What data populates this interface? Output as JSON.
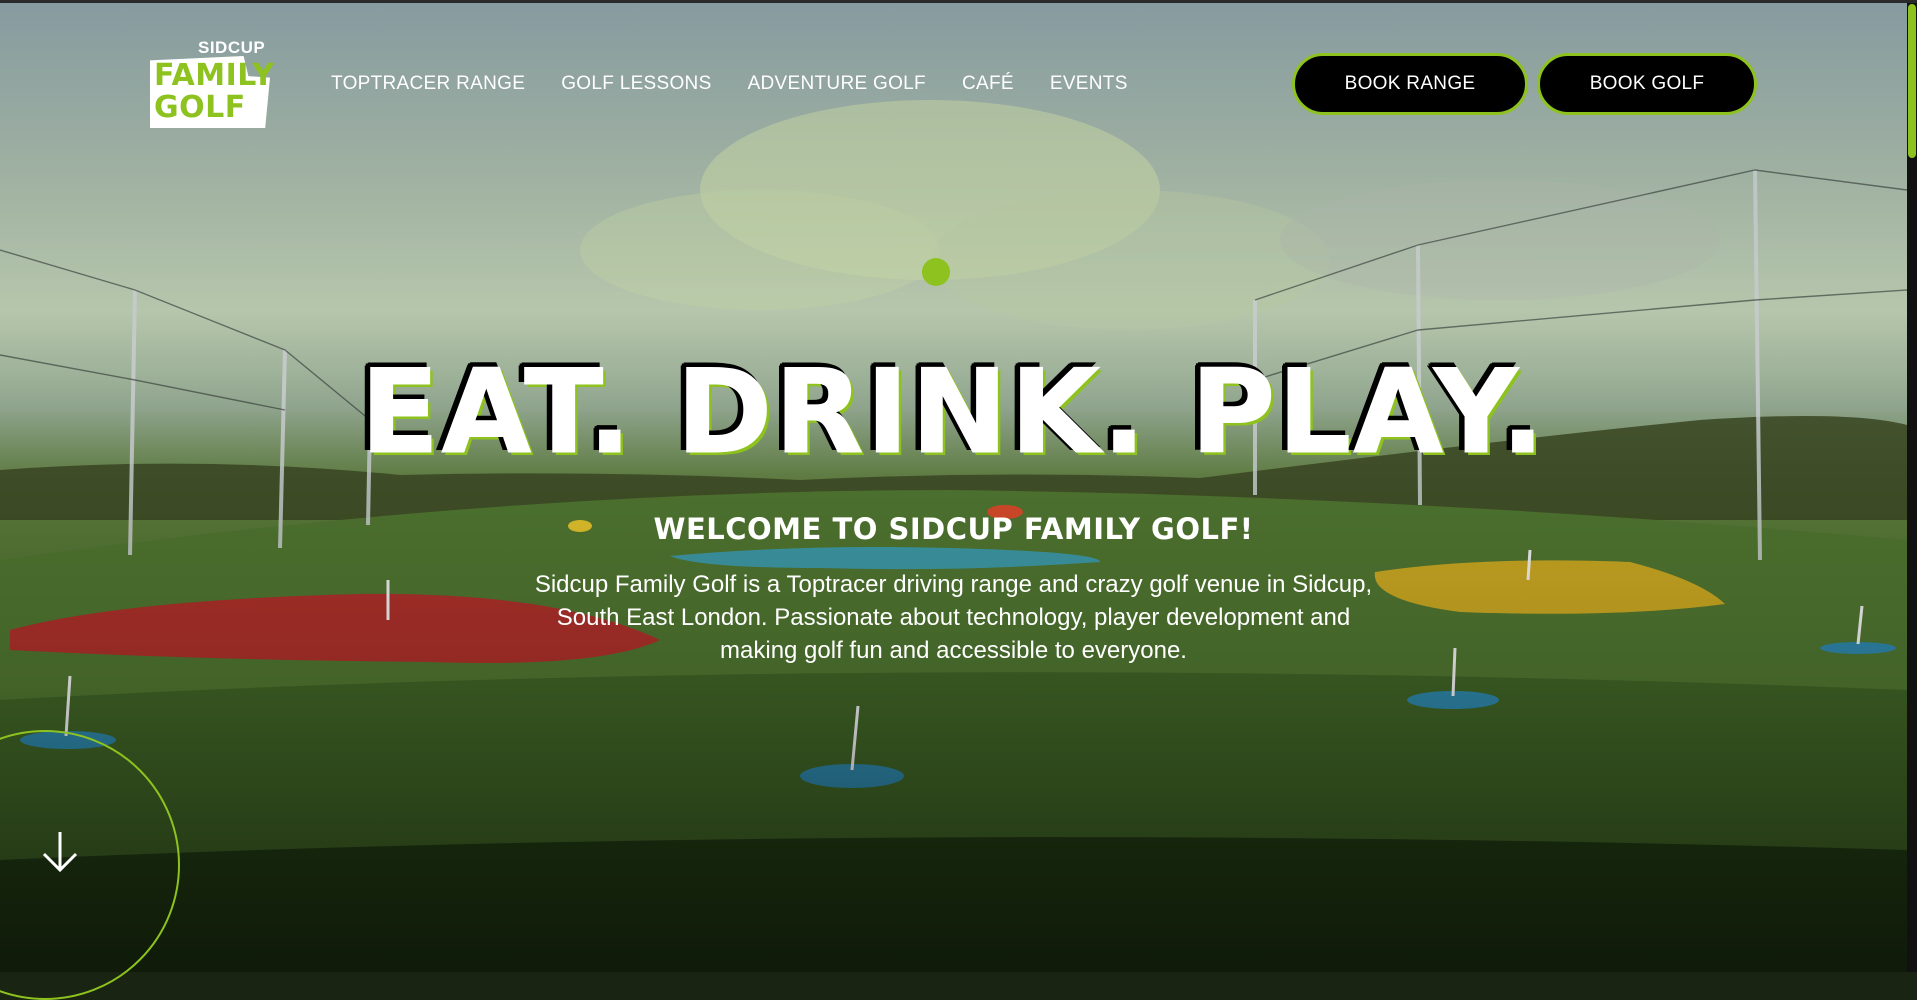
{
  "brand": {
    "top": "SIDCUP",
    "line1": "FAMILY",
    "line2": "GOLF"
  },
  "nav": {
    "items": [
      "TOPTRACER RANGE",
      "GOLF LESSONS",
      "ADVENTURE GOLF",
      "CAFÉ",
      "EVENTS"
    ]
  },
  "buttons": {
    "book_range": "BOOK RANGE",
    "book_golf": "BOOK GOLF"
  },
  "hero": {
    "headline": "EAT. DRINK. PLAY.",
    "welcome": "WELCOME TO SIDCUP FAMILY GOLF!",
    "intro": "Sidcup Family Golf is a Toptracer driving range and crazy golf venue in Sidcup, South East London. Passionate about technology, player development and making golf fun and accessible to everyone."
  },
  "icons": {
    "scroll_down": "arrow-down-icon"
  },
  "colors": {
    "accent": "#8dc21f",
    "button_bg": "#000000",
    "text": "#ffffff"
  }
}
